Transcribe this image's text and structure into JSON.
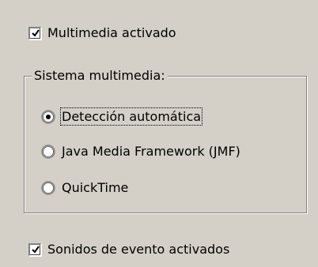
{
  "multimedia_checkbox": {
    "label": "Multimedia activado",
    "checked": true
  },
  "multimedia_group": {
    "title": "Sistema multimedia:",
    "options": [
      {
        "label": "Detección automática",
        "selected": true,
        "focused": true
      },
      {
        "label": "Java Media Framework (JMF)",
        "selected": false,
        "focused": false
      },
      {
        "label": "QuickTime",
        "selected": false,
        "focused": false
      }
    ]
  },
  "event_sounds_checkbox": {
    "label": "Sonidos de evento activados",
    "checked": true
  }
}
